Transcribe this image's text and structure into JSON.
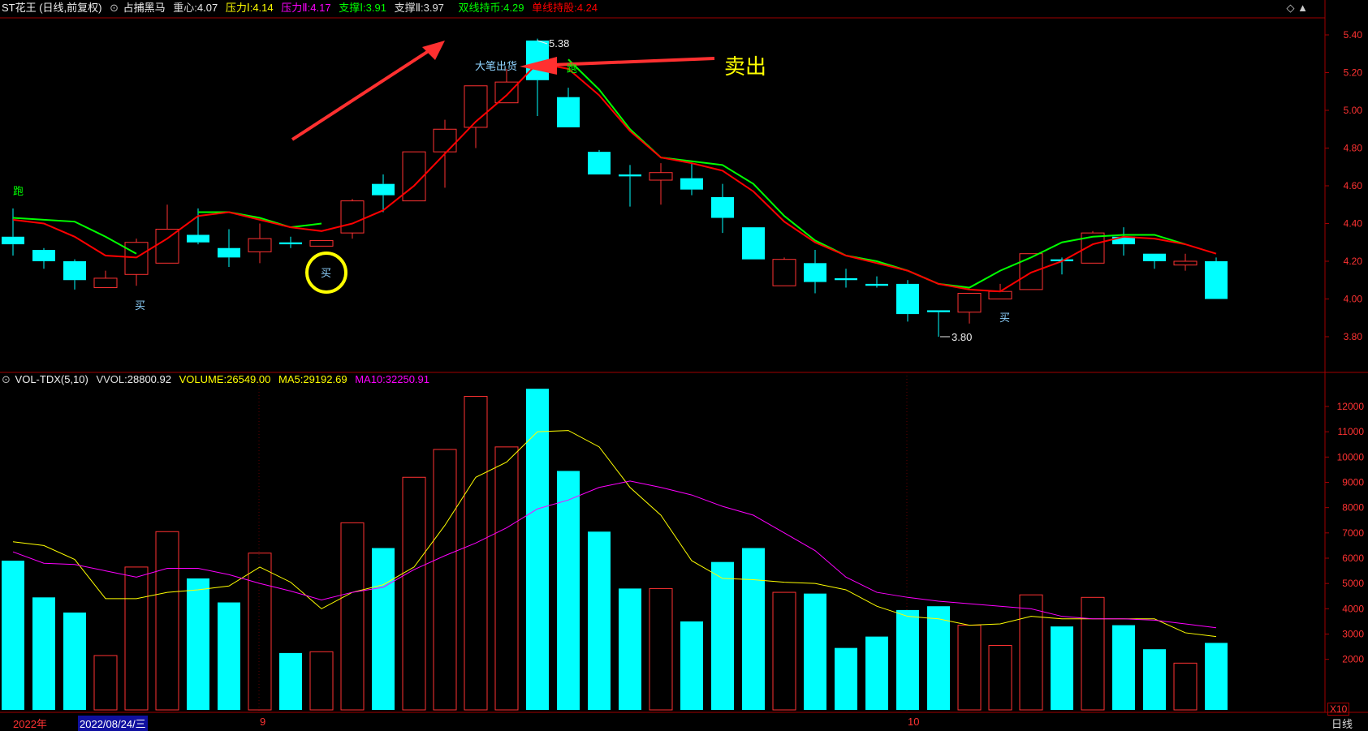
{
  "header": {
    "title": "ST花王 (日线,前复权)",
    "indicator": "占捕黑马",
    "zhongxin_label": "重心:",
    "zhongxin": "4.07",
    "yali1_label": "压力Ⅰ:",
    "yali1": "4.14",
    "yali2_label": "压力Ⅱ:",
    "yali2": "4.17",
    "zhicheng1_label": "支撑Ⅰ:",
    "zhicheng1": "3.91",
    "zhicheng2_label": "支撑Ⅱ:",
    "zhicheng2": "3.97",
    "shuangxian_label": "双线持币:",
    "shuangxian": "4.29",
    "danxian_label": "单线持股:",
    "danxian": "4.24"
  },
  "corner_icons": "◇ ▲",
  "volume_header": {
    "name": "VOL-TDX(5,10)",
    "vvol_label": "VVOL:",
    "vvol": "28800.92",
    "volume_label": "VOLUME:",
    "volume": "26549.00",
    "ma5_label": "MA5:",
    "ma5": "29192.69",
    "ma10_label": "MA10:",
    "ma10": "32250.91"
  },
  "annotations": {
    "sell": "卖出",
    "big_sell": "大笔出货",
    "high_price": "5.38",
    "low_price": "3.80",
    "buy": "买",
    "run": "跑"
  },
  "bottom_bar": {
    "year": "2022年",
    "date": "2022/08/24/三",
    "month9": "9",
    "month10": "10",
    "period": "日线",
    "zoom": "X10"
  },
  "colors": {
    "up": "#ff3232",
    "down": "#00ffff",
    "red_line": "#ff0000",
    "green_line": "#00ff00",
    "ma5": "#ffff00",
    "ma10": "#ff00ff",
    "axis": "#a00000",
    "yellow": "#ffff00",
    "buy_label": "#8fd3ff"
  },
  "chart_data": [
    {
      "type": "candlestick",
      "ylim": [
        3.65,
        5.45
      ],
      "yticks": [
        "5.40",
        "5.20",
        "5.00",
        "4.80",
        "4.60",
        "4.40",
        "4.20",
        "4.00",
        "3.80"
      ],
      "candles": [
        {
          "o": 4.33,
          "c": 4.29,
          "h": 4.48,
          "l": 4.23
        },
        {
          "o": 4.26,
          "c": 4.2,
          "h": 4.27,
          "l": 4.16
        },
        {
          "o": 4.2,
          "c": 4.1,
          "h": 4.21,
          "l": 4.05
        },
        {
          "o": 4.06,
          "c": 4.11,
          "h": 4.15,
          "l": 4.06
        },
        {
          "o": 4.13,
          "c": 4.3,
          "h": 4.32,
          "l": 4.07
        },
        {
          "o": 4.19,
          "c": 4.37,
          "h": 4.5,
          "l": 4.19
        },
        {
          "o": 4.34,
          "c": 4.3,
          "h": 4.48,
          "l": 4.29
        },
        {
          "o": 4.27,
          "c": 4.22,
          "h": 4.37,
          "l": 4.17
        },
        {
          "o": 4.25,
          "c": 4.32,
          "h": 4.4,
          "l": 4.19
        },
        {
          "o": 4.3,
          "c": 4.29,
          "h": 4.33,
          "l": 4.27
        },
        {
          "o": 4.28,
          "c": 4.31,
          "h": 4.31,
          "l": 4.28
        },
        {
          "o": 4.35,
          "c": 4.52,
          "h": 4.53,
          "l": 4.32
        },
        {
          "o": 4.61,
          "c": 4.55,
          "h": 4.66,
          "l": 4.46
        },
        {
          "o": 4.52,
          "c": 4.78,
          "h": 4.78,
          "l": 4.52
        },
        {
          "o": 4.78,
          "c": 4.9,
          "h": 4.95,
          "l": 4.59
        },
        {
          "o": 4.91,
          "c": 5.13,
          "h": 5.13,
          "l": 4.8
        },
        {
          "o": 5.04,
          "c": 5.15,
          "h": 5.22,
          "l": 5.04
        },
        {
          "o": 5.37,
          "c": 5.16,
          "h": 5.38,
          "l": 4.97
        },
        {
          "o": 5.07,
          "c": 4.91,
          "h": 5.12,
          "l": 4.91
        },
        {
          "o": 4.78,
          "c": 4.66,
          "h": 4.79,
          "l": 4.66
        },
        {
          "o": 4.66,
          "c": 4.65,
          "h": 4.71,
          "l": 4.49
        },
        {
          "o": 4.63,
          "c": 4.67,
          "h": 4.72,
          "l": 4.5
        },
        {
          "o": 4.64,
          "c": 4.58,
          "h": 4.72,
          "l": 4.55
        },
        {
          "o": 4.54,
          "c": 4.43,
          "h": 4.61,
          "l": 4.35
        },
        {
          "o": 4.38,
          "c": 4.21,
          "h": 4.38,
          "l": 4.21
        },
        {
          "o": 4.07,
          "c": 4.21,
          "h": 4.22,
          "l": 4.07
        },
        {
          "o": 4.19,
          "c": 4.09,
          "h": 4.26,
          "l": 4.03
        },
        {
          "o": 4.11,
          "c": 4.1,
          "h": 4.16,
          "l": 4.06
        },
        {
          "o": 4.08,
          "c": 4.07,
          "h": 4.12,
          "l": 4.06
        },
        {
          "o": 4.08,
          "c": 3.92,
          "h": 4.1,
          "l": 3.88
        },
        {
          "o": 3.94,
          "c": 3.93,
          "h": 3.94,
          "l": 3.8
        },
        {
          "o": 3.93,
          "c": 4.03,
          "h": 4.03,
          "l": 3.87
        },
        {
          "o": 4.0,
          "c": 4.04,
          "h": 4.08,
          "l": 4.0
        },
        {
          "o": 4.05,
          "c": 4.24,
          "h": 4.24,
          "l": 4.05
        },
        {
          "o": 4.21,
          "c": 4.2,
          "h": 4.22,
          "l": 4.13
        },
        {
          "o": 4.19,
          "c": 4.35,
          "h": 4.36,
          "l": 4.19
        },
        {
          "o": 4.33,
          "c": 4.29,
          "h": 4.38,
          "l": 4.23
        },
        {
          "o": 4.24,
          "c": 4.2,
          "h": 4.24,
          "l": 4.16
        },
        {
          "o": 4.18,
          "c": 4.2,
          "h": 4.24,
          "l": 4.15
        },
        {
          "o": 4.2,
          "c": 4.0,
          "h": 4.22,
          "l": 4.0
        }
      ],
      "red_line": [
        4.42,
        4.4,
        4.33,
        4.23,
        4.22,
        4.32,
        4.44,
        4.46,
        4.42,
        4.38,
        4.36,
        4.4,
        4.47,
        4.6,
        4.77,
        4.94,
        5.08,
        5.25,
        5.22,
        5.08,
        4.89,
        4.75,
        4.72,
        4.68,
        4.57,
        4.41,
        4.3,
        4.23,
        4.19,
        4.15,
        4.08,
        4.05,
        4.04,
        4.14,
        4.2,
        4.29,
        4.33,
        4.32,
        4.29,
        4.24
      ],
      "green_line": [
        4.43,
        4.42,
        4.41,
        4.33,
        4.24
      ],
      "green_line2": [
        5.27,
        5.11,
        4.9,
        4.75,
        4.73,
        4.71,
        4.61,
        4.44,
        4.31,
        4.23,
        4.2,
        4.15,
        4.08,
        4.06,
        4.15,
        4.22,
        4.3,
        4.33,
        4.34,
        4.34,
        4.29
      ],
      "green_line3": [
        4.46,
        4.46,
        4.43,
        4.38,
        4.4
      ]
    },
    {
      "type": "bar",
      "ylim": [
        0,
        13000
      ],
      "yticks": [
        "12000",
        "11000",
        "10000",
        "9000",
        "8000",
        "7000",
        "6000",
        "5000",
        "4000",
        "3000",
        "2000"
      ],
      "volumes": [
        5900,
        4450,
        3850,
        2150,
        5650,
        7050,
        5200,
        4250,
        6200,
        2250,
        2300,
        7400,
        6400,
        9200,
        10300,
        12400,
        10400,
        12700,
        9450,
        7050,
        4800,
        4800,
        3500,
        5850,
        6400,
        4650,
        4600,
        2450,
        2900,
        3950,
        4100,
        3350,
        2550,
        4550,
        3300,
        4450,
        3350,
        2400,
        1850,
        2650
      ],
      "ma5": [
        6650,
        6500,
        5950,
        4400,
        4400,
        4650,
        4750,
        4900,
        5650,
        5050,
        4000,
        4650,
        4950,
        5650,
        7300,
        9200,
        9800,
        11000,
        11050,
        10400,
        8800,
        7700,
        5900,
        5200,
        5150,
        5050,
        5000,
        4750,
        4100,
        3700,
        3600,
        3350,
        3400,
        3700,
        3600,
        3600,
        3600,
        3600,
        3050,
        2900
      ],
      "ma10": [
        6250,
        5800,
        5750,
        5500,
        5250,
        5600,
        5600,
        5350,
        5000,
        4700,
        4350,
        4650,
        4850,
        5550,
        6100,
        6600,
        7200,
        7950,
        8300,
        8800,
        9050,
        8800,
        8500,
        8050,
        7700,
        7000,
        6300,
        5250,
        4650,
        4450,
        4300,
        4200,
        4100,
        4000,
        3700,
        3600,
        3600,
        3550,
        3400,
        3250
      ]
    }
  ]
}
